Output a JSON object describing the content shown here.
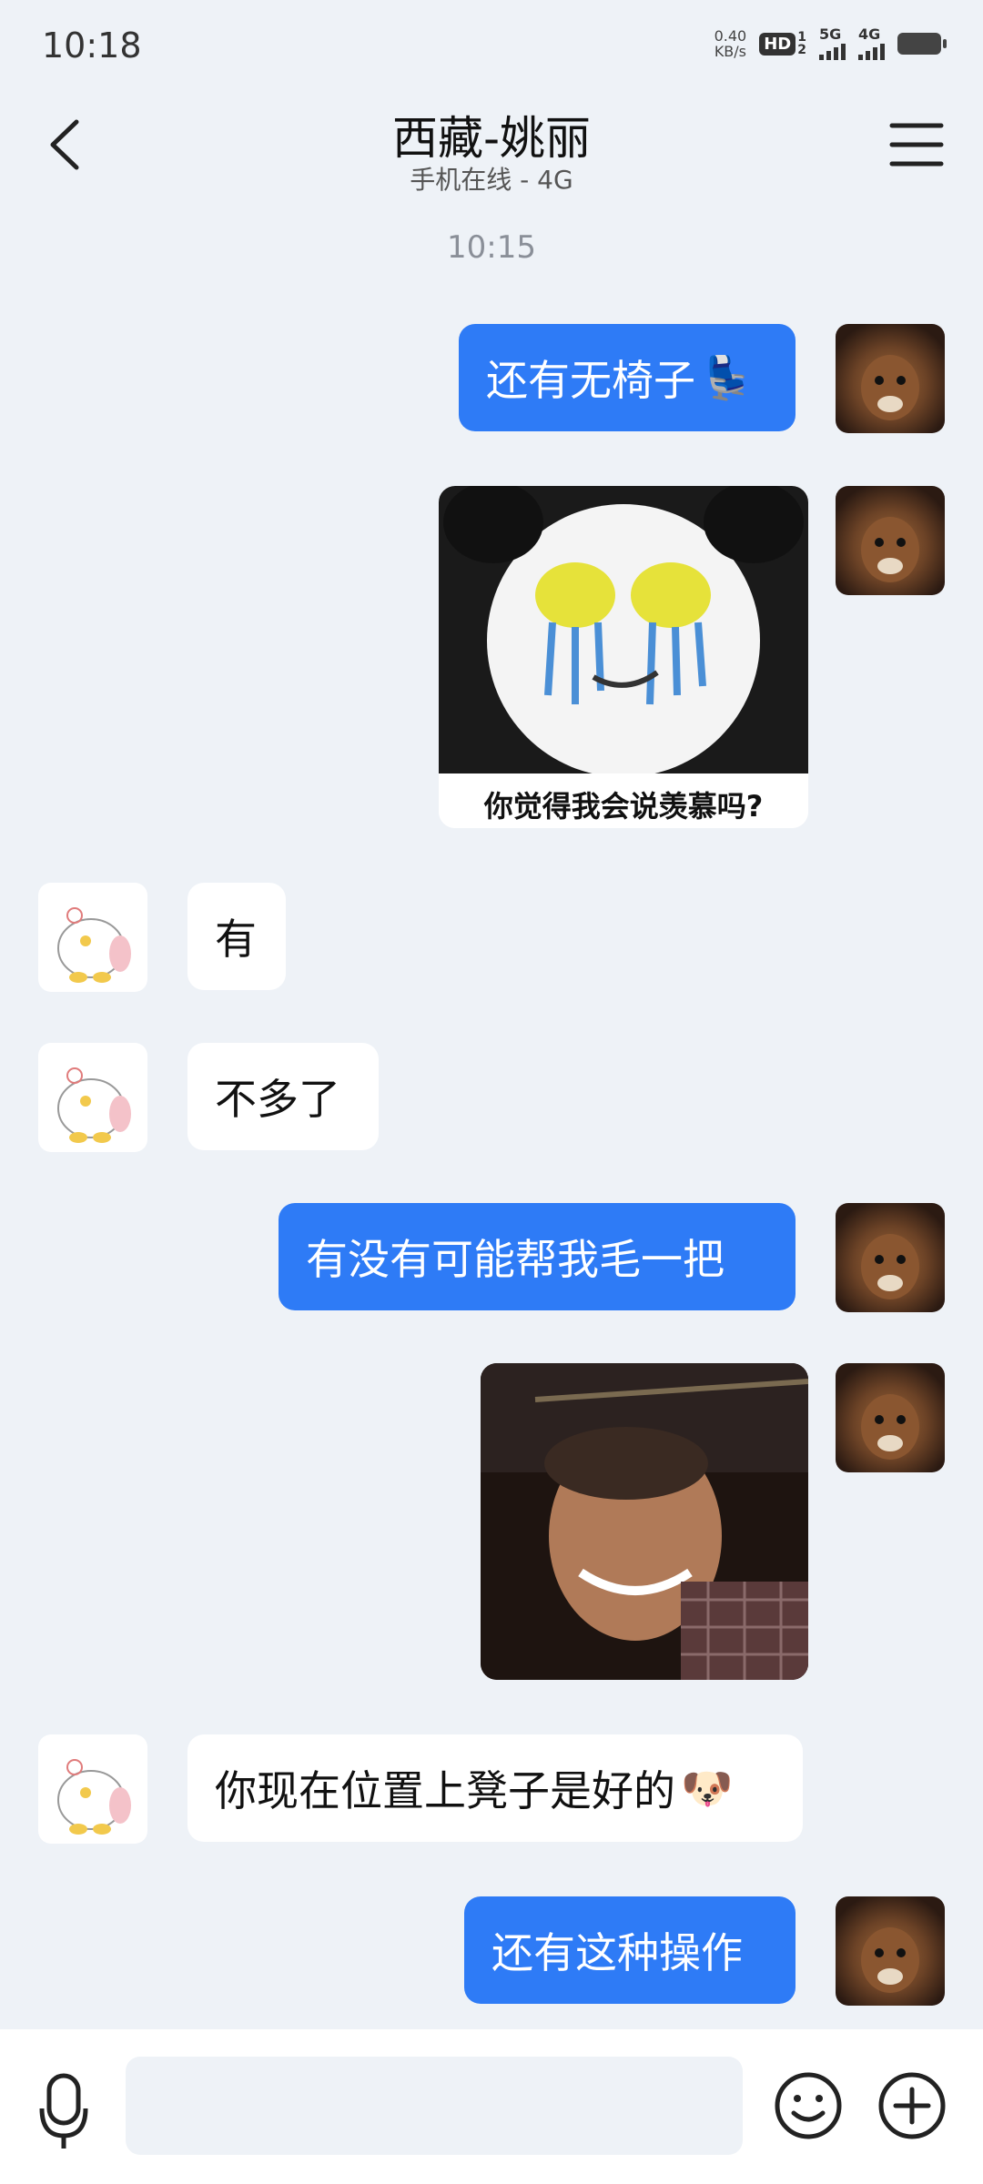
{
  "status_bar": {
    "time": "10:18",
    "net_speed_value": "0.40",
    "net_speed_unit": "KB/s",
    "hd_badge": "HD",
    "hd_sup": "1",
    "hd_sub": "2",
    "signal1_label": "5G",
    "signal2_label": "4G"
  },
  "header": {
    "title": "西藏-姚丽",
    "subtitle": "手机在线 - 4G"
  },
  "chat": {
    "timestamp": "10:15",
    "messages": [
      {
        "side": "out",
        "type": "text",
        "text": "还有无椅子",
        "emoji": "💺"
      },
      {
        "side": "out",
        "type": "sticker",
        "caption": "你觉得我会说羡慕吗?"
      },
      {
        "side": "in",
        "type": "text",
        "text": "有"
      },
      {
        "side": "in",
        "type": "text",
        "text": "不多了"
      },
      {
        "side": "out",
        "type": "text",
        "text": "有没有可能帮我毛一把"
      },
      {
        "side": "out",
        "type": "image"
      },
      {
        "side": "in",
        "type": "text",
        "text": "你现在位置上凳子是好的",
        "emoji": "🐶"
      },
      {
        "side": "out",
        "type": "text",
        "text": "还有这种操作"
      }
    ]
  },
  "input_bar": {
    "placeholder": ""
  },
  "colors": {
    "outgoing_bubble": "#2e7bf6",
    "incoming_bubble": "#ffffff",
    "background": "#eef2f7"
  },
  "icons": [
    "back-chevron-icon",
    "menu-icon",
    "microphone-icon",
    "emoji-icon",
    "plus-icon"
  ]
}
